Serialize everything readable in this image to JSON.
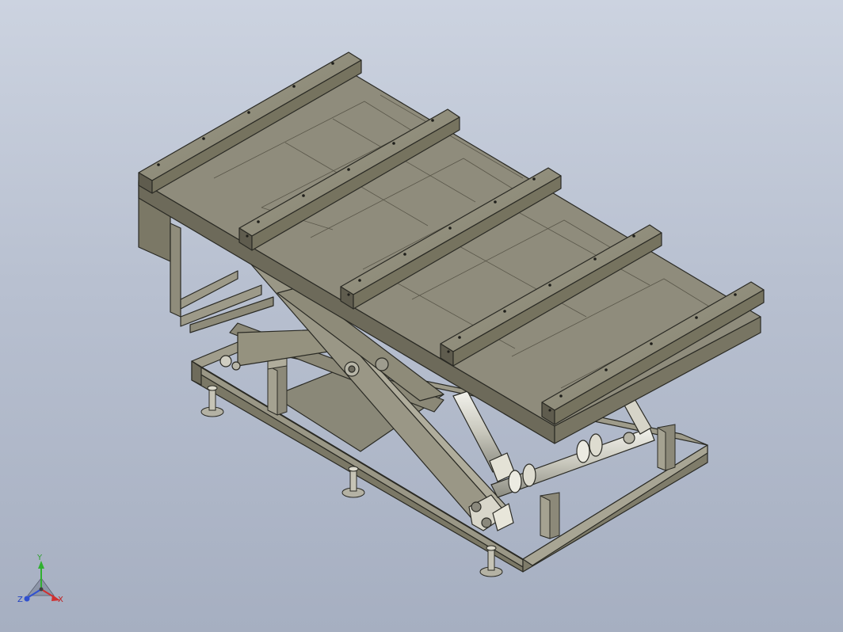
{
  "viewport": {
    "background_top": "#ccd3e0",
    "background_bottom": "#a6afc1",
    "model": "scissor-lift-table",
    "model_color": "#8f8c7c",
    "edge_color": "#2a2a24"
  },
  "triad": {
    "x_label": "X",
    "y_label": "Y",
    "z_label": "Z",
    "x_color": "#d03030",
    "y_color": "#30b030",
    "z_color": "#3050d0"
  }
}
